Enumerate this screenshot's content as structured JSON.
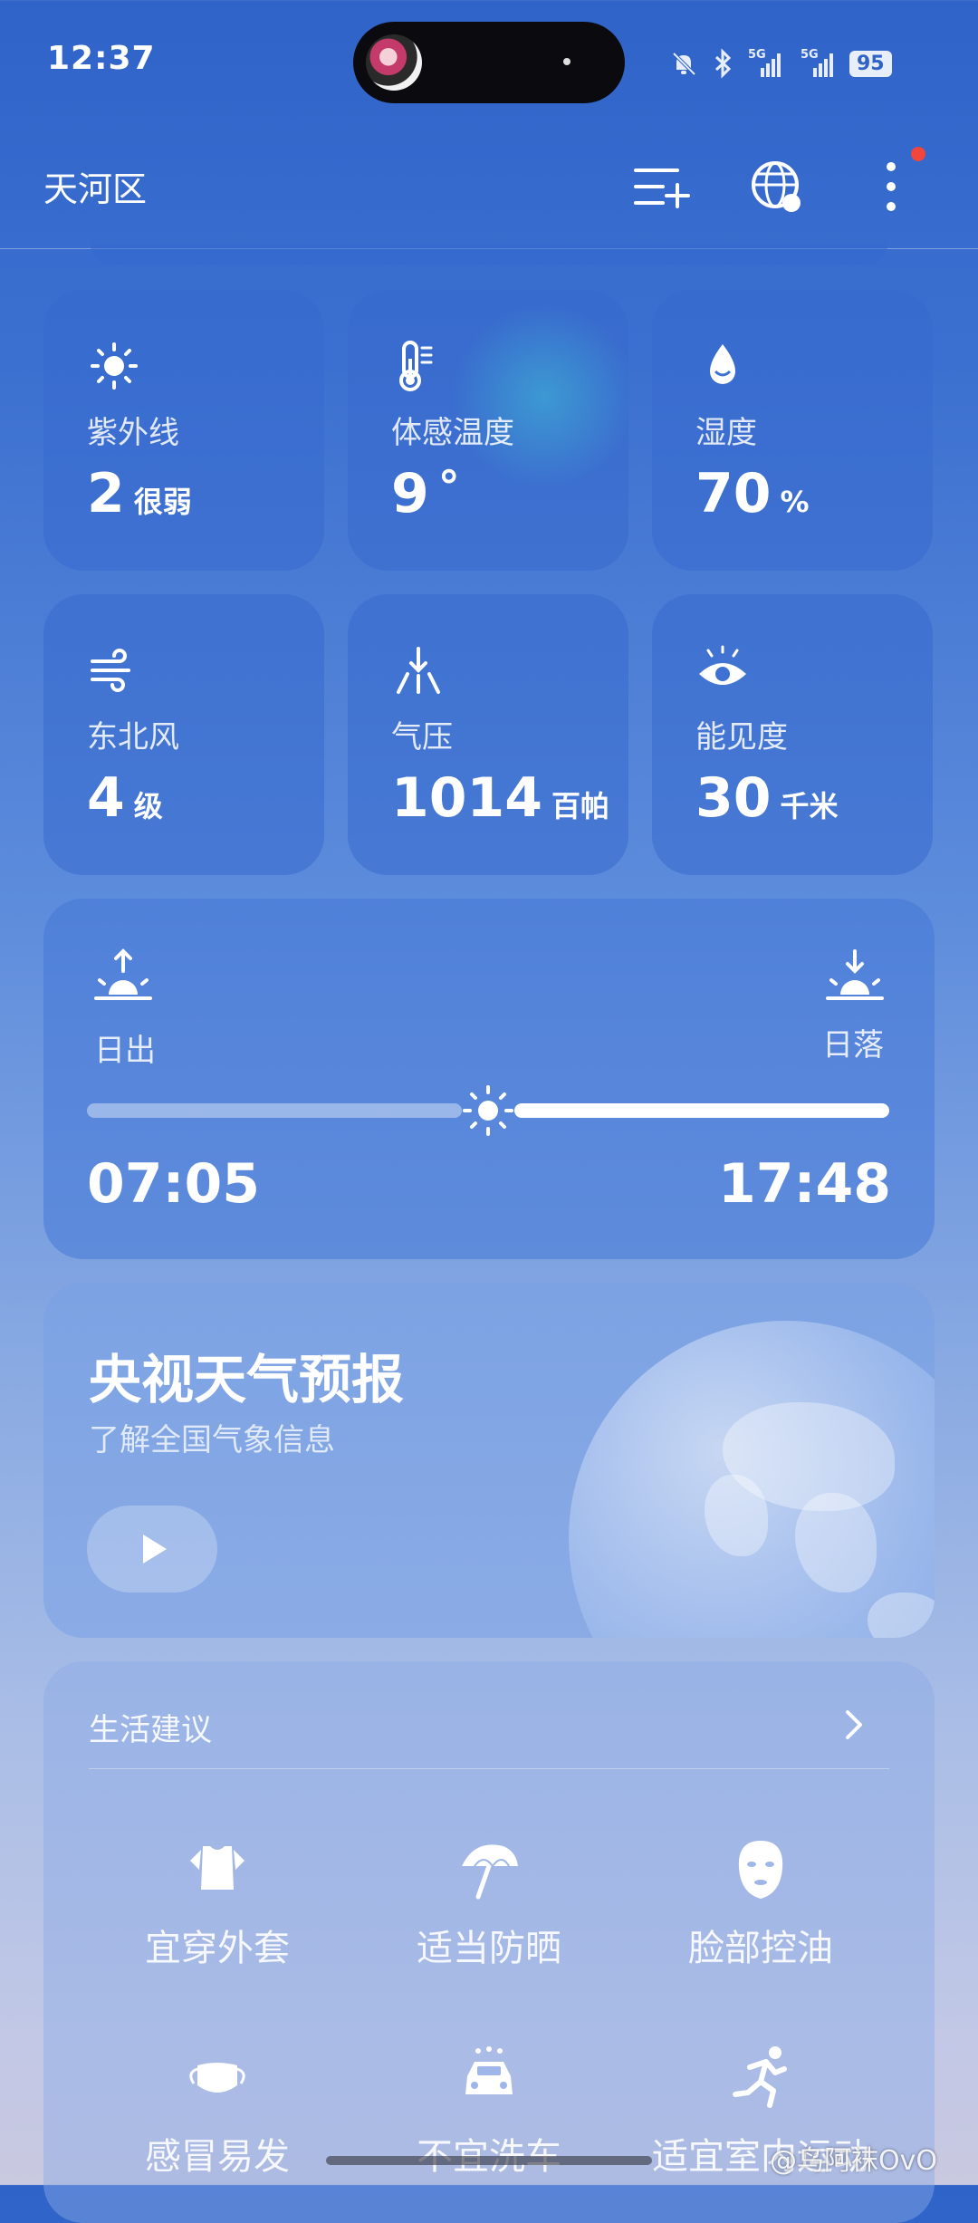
{
  "status_bar": {
    "time": "12:37",
    "net1": "5G",
    "net2": "5G",
    "battery": "95"
  },
  "header": {
    "location": "天河区",
    "icons": [
      "add-city-icon",
      "globe-icon",
      "more-icon"
    ]
  },
  "tiles": [
    {
      "label": "紫外线",
      "value": "2",
      "unit": "很弱",
      "icon": "sun-icon"
    },
    {
      "label": "体感温度",
      "value": "9",
      "unit": "°",
      "icon": "thermometer-icon"
    },
    {
      "label": "湿度",
      "value": "70",
      "unit": "%",
      "icon": "droplet-icon"
    },
    {
      "label": "东北风",
      "value": "4",
      "unit": "级",
      "icon": "wind-icon"
    },
    {
      "label": "气压",
      "value": "1014",
      "unit": "百帕",
      "icon": "pressure-icon"
    },
    {
      "label": "能见度",
      "value": "30",
      "unit": "千米",
      "icon": "eye-icon"
    }
  ],
  "sun": {
    "sunrise_label": "日出",
    "sunset_label": "日落",
    "sunrise_time": "07:05",
    "sunset_time": "17:48",
    "progress": 0.5
  },
  "cctv": {
    "title": "央视天气预报",
    "subtitle": "了解全国气象信息"
  },
  "life": {
    "title": "生活建议",
    "items": [
      {
        "label": "宜穿外套",
        "icon": "jacket-icon"
      },
      {
        "label": "适当防晒",
        "icon": "umbrella-icon"
      },
      {
        "label": "脸部控油",
        "icon": "face-mask-icon"
      },
      {
        "label": "感冒易发",
        "icon": "medical-mask-icon"
      },
      {
        "label": "不宜洗车",
        "icon": "car-wash-icon"
      },
      {
        "label": "适宜室内运动",
        "icon": "running-icon"
      }
    ]
  },
  "watermark": "@鸟阿袜OvO",
  "colors": {
    "accent": "#2f63c8",
    "alert_dot": "#f0463c"
  }
}
